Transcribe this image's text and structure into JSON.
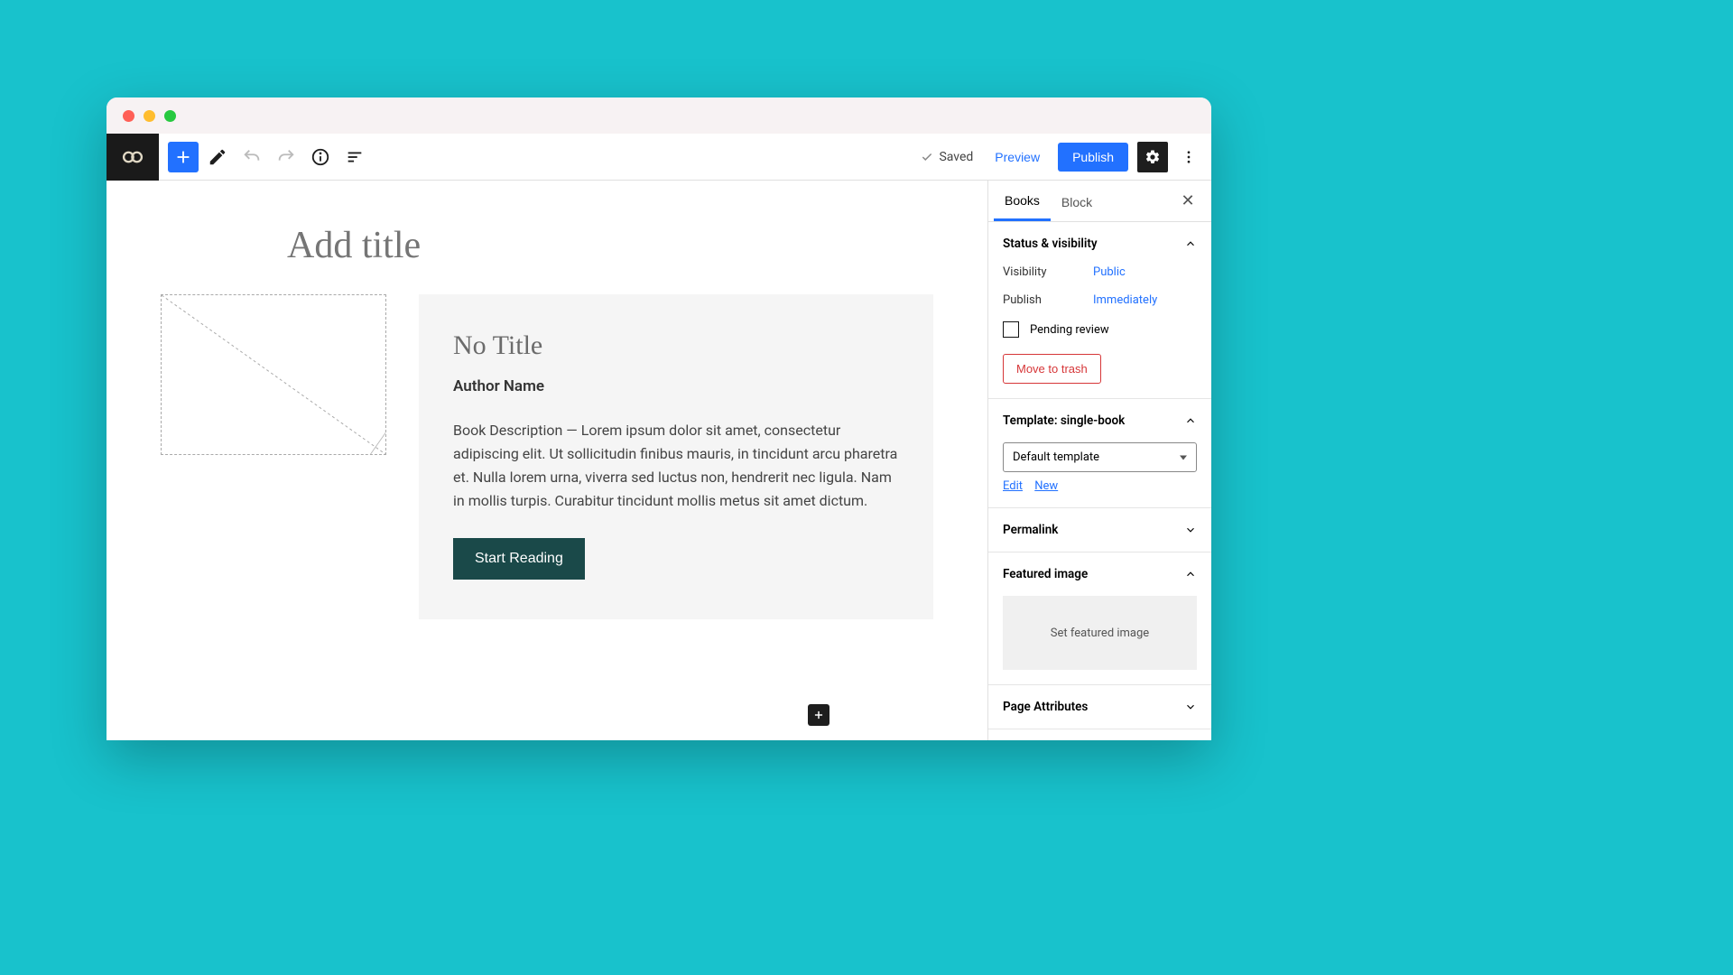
{
  "topbar": {
    "saved_label": "Saved",
    "preview_label": "Preview",
    "publish_label": "Publish"
  },
  "canvas": {
    "title_placeholder": "Add title",
    "card": {
      "title": "No Title",
      "author": "Author Name",
      "description": "Book Description — Lorem ipsum dolor sit amet, consectetur adipiscing elit. Ut sollicitudin finibus mauris, in tincidunt arcu pharetra et. Nulla lorem urna, viverra sed luctus non, hendrerit nec ligula. Nam in mollis turpis. Curabitur tincidunt mollis metus sit amet dictum.",
      "cta": "Start Reading"
    }
  },
  "sidebar": {
    "tabs": {
      "books": "Books",
      "block": "Block"
    },
    "status": {
      "heading": "Status & visibility",
      "visibility_label": "Visibility",
      "visibility_value": "Public",
      "publish_label": "Publish",
      "publish_value": "Immediately",
      "pending_review": "Pending review",
      "trash": "Move to trash"
    },
    "template": {
      "heading": "Template: single-book",
      "selected": "Default template",
      "edit": "Edit",
      "new": "New"
    },
    "permalink": {
      "heading": "Permalink"
    },
    "featured": {
      "heading": "Featured image",
      "placeholder": "Set featured image"
    },
    "page_attrs": {
      "heading": "Page Attributes"
    }
  }
}
